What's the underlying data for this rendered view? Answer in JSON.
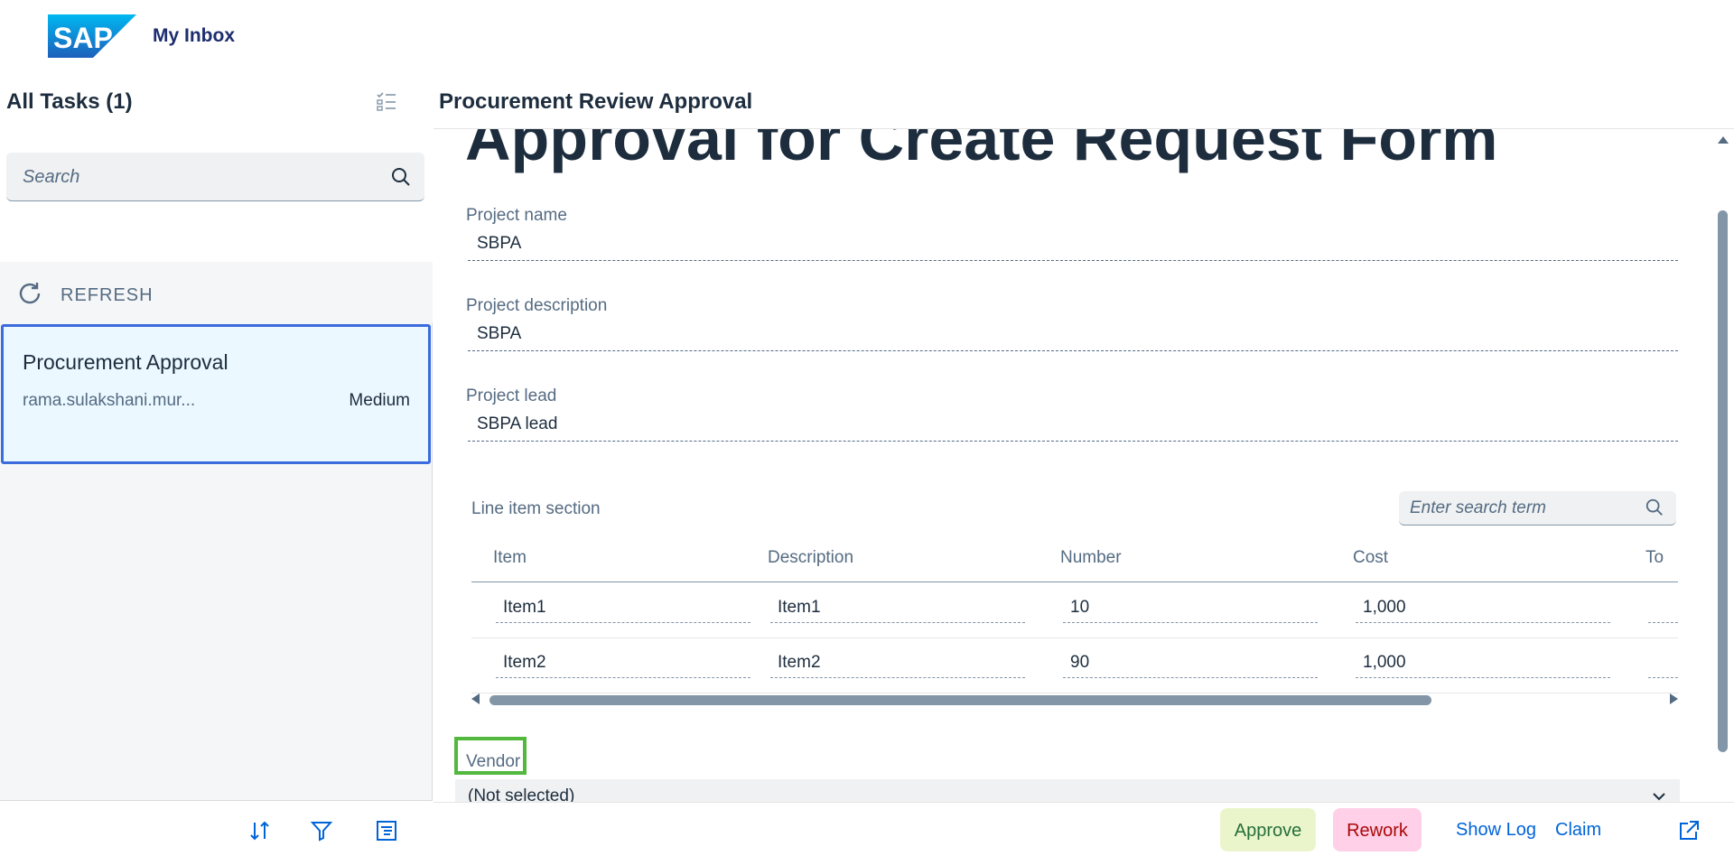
{
  "shell": {
    "title": "My Inbox",
    "logo_text": "SAP"
  },
  "master": {
    "title": "All Tasks (1)",
    "search_placeholder": "Search",
    "refresh_label": "REFRESH",
    "tasks": [
      {
        "title": "Procurement Approval",
        "creator": "rama.sulakshani.mur...",
        "priority": "Medium"
      }
    ]
  },
  "detail": {
    "title": "Procurement Review Approval",
    "form_title": "Approval for Create Request Form",
    "fields": [
      {
        "label": "Project name",
        "value": "SBPA"
      },
      {
        "label": "Project description",
        "value": "SBPA"
      },
      {
        "label": "Project lead",
        "value": "SBPA lead"
      }
    ],
    "line_items": {
      "label": "Line item section",
      "search_placeholder": "Enter search term",
      "columns": [
        "Item",
        "Description",
        "Number",
        "Cost",
        "To"
      ],
      "rows": [
        [
          "Item1",
          "Item1",
          "10",
          "1,000"
        ],
        [
          "Item2",
          "Item2",
          "90",
          "1,000"
        ]
      ]
    },
    "vendor": {
      "label": "Vendor",
      "value": "(Not selected)"
    }
  },
  "footer": {
    "approve": "Approve",
    "rework": "Rework",
    "show_log": "Show Log",
    "claim": "Claim"
  },
  "colors": {
    "accent": "#0064d9",
    "selected_border": "#3b6bdc",
    "selected_bg": "#ebf8ff",
    "approve_bg": "#ebf5cb",
    "rework_bg": "#ffd0e7",
    "highlight_frame": "#52b83e",
    "sap_blue": "#0070f2"
  },
  "icons": [
    "sap-logo",
    "multi-select-icon",
    "search-icon",
    "refresh-icon",
    "sort-icon",
    "filter-icon",
    "group-icon",
    "chevron-down-icon",
    "share-icon"
  ]
}
